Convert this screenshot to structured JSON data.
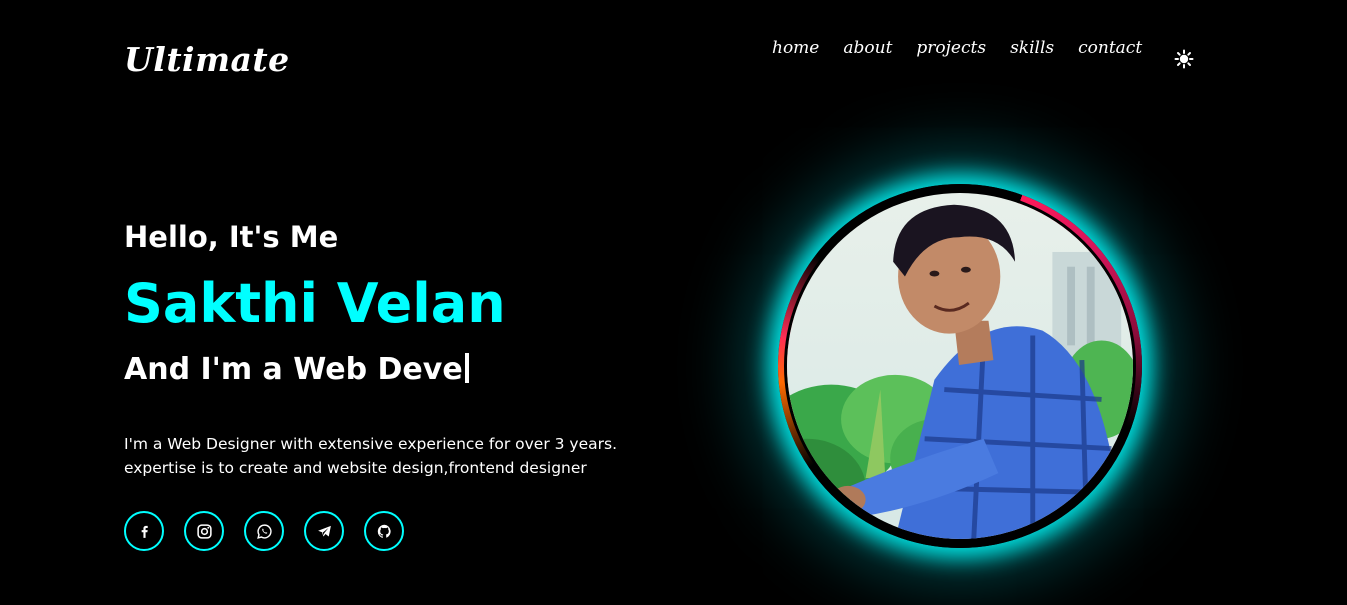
{
  "header": {
    "logo": "Ultimate",
    "nav": [
      "home",
      "about",
      "projects",
      "skills",
      "contact"
    ],
    "theme_icon": "sun-icon"
  },
  "hero": {
    "greeting": "Hello, It's Me",
    "name": "Sakthi Velan",
    "role": "And I'm a Web Deve",
    "description_line1": "I'm a Web Designer with extensive experience for over 3 years.",
    "description_line2": "expertise is to create and website design,frontend designer"
  },
  "socials": [
    "facebook-icon",
    "instagram-icon",
    "whatsapp-icon",
    "telegram-icon",
    "github-icon"
  ],
  "colors": {
    "accent": "#00ffff",
    "background": "#000000",
    "text": "#ffffff"
  }
}
